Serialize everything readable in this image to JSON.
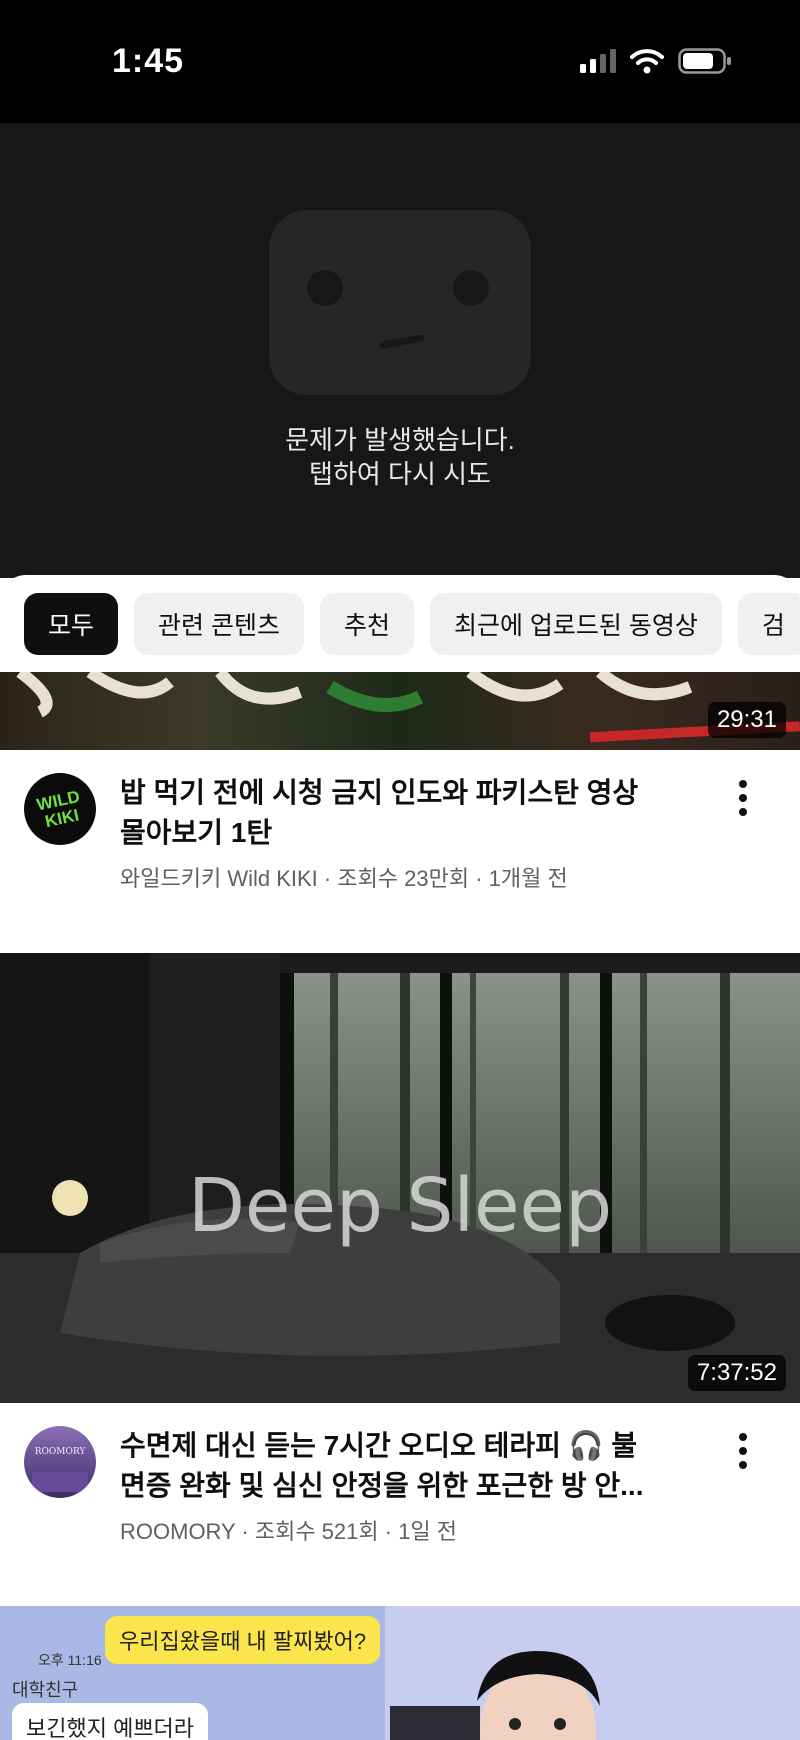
{
  "status_bar": {
    "time": "1:45"
  },
  "player": {
    "error_line1": "문제가 발생했습니다.",
    "error_line2": "탭하여 다시 시도"
  },
  "chips": [
    "모두",
    "관련 콘텐츠",
    "추천",
    "최근에 업로드된 동영상",
    "검"
  ],
  "videos": [
    {
      "duration": "29:31",
      "title_line1": "밥 먹기 전에 시청 금지 인도와 파키스탄 영상",
      "title_line2": "몰아보기 1탄",
      "meta": "와일드키키 Wild KIKI · 조회수 23만회 · 1개월 전",
      "avatar_text": "WILD KIKI"
    },
    {
      "duration": "7:37:52",
      "thumb_text": "Deep Sleep",
      "title_line1": "수면제 대신 듣는 7시간 오디오 테라피 🎧 불",
      "title_line2": "면증 완화 및 심신 안정을 위한 포근한 방 안...",
      "meta": "ROOMORY · 조회수 521회 · 1일 전",
      "avatar_text": "ROOMORY"
    },
    {
      "thumb_bubble_top": "우리집왔을때 내 팔찌봤어?",
      "thumb_time": "오후 11:16",
      "thumb_name": "대학친구",
      "thumb_bubble_bottom": "보긴했지 예쁘더라"
    }
  ]
}
